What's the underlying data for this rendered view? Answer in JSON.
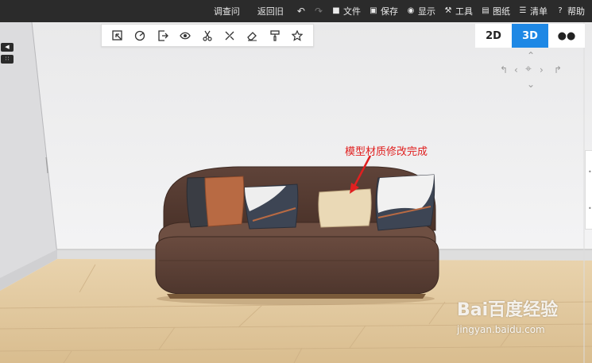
{
  "topbar": {
    "survey": "调查问",
    "back_old": "返回旧",
    "undo_icon": "undo-icon",
    "redo_icon": "redo-icon",
    "menus": [
      {
        "label": "文件",
        "icon": "folder-icon"
      },
      {
        "label": "保存",
        "icon": "save-icon"
      },
      {
        "label": "显示",
        "icon": "eye-icon"
      },
      {
        "label": "工具",
        "icon": "wrench-icon"
      },
      {
        "label": "图纸",
        "icon": "map-icon"
      },
      {
        "label": "清单",
        "icon": "list-icon"
      },
      {
        "label": "帮助",
        "icon": "help-icon"
      }
    ]
  },
  "tools": [
    "select-icon",
    "measure-icon",
    "exit-icon",
    "eye-icon",
    "cut-icon",
    "split-icon",
    "eraser-icon",
    "paint-roller-icon",
    "star-icon"
  ],
  "views": {
    "v2d": "2D",
    "v3d": "3D",
    "walk": "footprints-icon",
    "active": "3D"
  },
  "annotation": "模型材质修改完成",
  "watermark": {
    "logo": "Bai百度经验",
    "url": "jingyan.baidu.com"
  },
  "colors": {
    "accent": "#1e88e5",
    "topbar": "#2b2b2b",
    "annotation": "#e02020",
    "sofa": "#5b4035"
  }
}
